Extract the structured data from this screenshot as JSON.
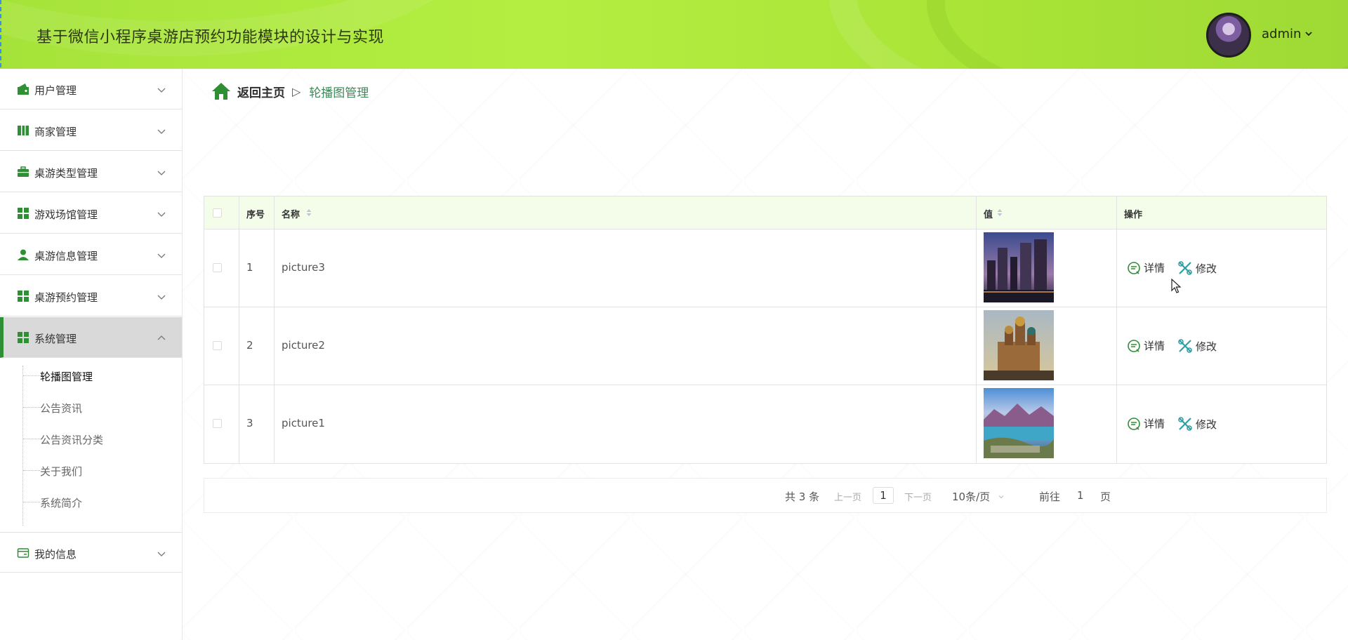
{
  "header": {
    "title": "基于微信小程序桌游店预约功能模块的设计与实现",
    "user_name": "admin"
  },
  "sidebar": {
    "items": [
      {
        "label": "用户管理",
        "icon": "wallet-icon"
      },
      {
        "label": "商家管理",
        "icon": "book-icon"
      },
      {
        "label": "桌游类型管理",
        "icon": "briefcase-icon"
      },
      {
        "label": "游戏场馆管理",
        "icon": "grid-icon"
      },
      {
        "label": "桌游信息管理",
        "icon": "user-icon"
      },
      {
        "label": "桌游预约管理",
        "icon": "grid-icon"
      },
      {
        "label": "系统管理",
        "icon": "grid-icon",
        "expanded": true
      },
      {
        "label": "我的信息",
        "icon": "card-icon"
      }
    ],
    "submenu": [
      {
        "label": "轮播图管理",
        "current": true
      },
      {
        "label": "公告资讯"
      },
      {
        "label": "公告资讯分类"
      },
      {
        "label": "关于我们"
      },
      {
        "label": "系统简介"
      }
    ]
  },
  "breadcrumb": {
    "home": "返回主页",
    "separator": "▷",
    "current": "轮播图管理"
  },
  "table": {
    "columns": [
      "序号",
      "名称",
      "值",
      "操作"
    ],
    "rows": [
      {
        "index": "1",
        "name": "picture3",
        "image": "city-skyline-at-dusk"
      },
      {
        "index": "2",
        "name": "picture2",
        "image": "ornate-cathedral"
      },
      {
        "index": "3",
        "name": "picture1",
        "image": "mountain-lake-landscape"
      }
    ],
    "actions": {
      "detail": "详情",
      "edit": "修改"
    }
  },
  "pagination": {
    "total": "共 3 条",
    "prev": "上一页",
    "page": "1",
    "next": "下一页",
    "page_size": "10条/页",
    "goto_label": "前往",
    "goto_value": "1",
    "goto_suffix": "页"
  },
  "colors": {
    "header_green": "#b4ee41",
    "accent_green": "#2f8f35",
    "table_head_bg": "#f3fde9",
    "breadcrumb_current": "#3b8a58"
  }
}
